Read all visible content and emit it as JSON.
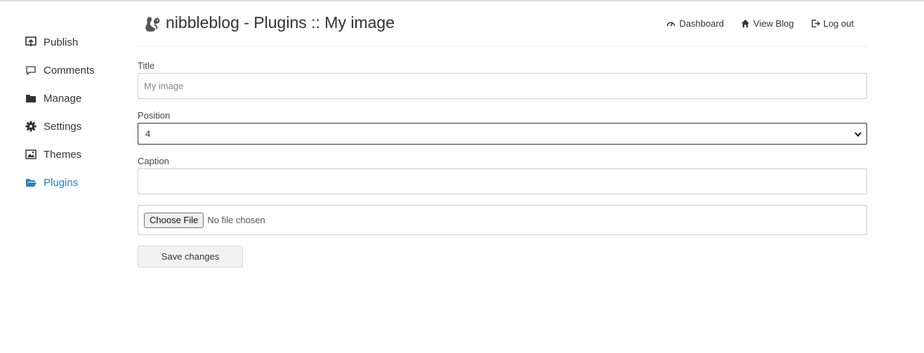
{
  "header": {
    "title": "nibbleblog - Plugins :: My image",
    "nav": [
      {
        "label": "Dashboard",
        "icon": "dashboard-icon"
      },
      {
        "label": "View Blog",
        "icon": "home-icon"
      },
      {
        "label": "Log out",
        "icon": "logout-icon"
      }
    ]
  },
  "sidebar": {
    "items": [
      {
        "label": "Publish",
        "icon": "publish-icon"
      },
      {
        "label": "Comments",
        "icon": "comment-icon"
      },
      {
        "label": "Manage",
        "icon": "folder-icon"
      },
      {
        "label": "Settings",
        "icon": "gear-icon"
      },
      {
        "label": "Themes",
        "icon": "image-icon"
      },
      {
        "label": "Plugins",
        "icon": "folder-open-icon",
        "active": true
      }
    ]
  },
  "form": {
    "title_label": "Title",
    "title_placeholder": "My image",
    "position_label": "Position",
    "position_value": "4",
    "caption_label": "Caption",
    "caption_value": "",
    "file_button": "Choose File",
    "file_status": "No file chosen",
    "save_label": "Save changes"
  },
  "colors": {
    "accent": "#2a80b9",
    "text": "#333333",
    "border": "#cfcfcf"
  }
}
